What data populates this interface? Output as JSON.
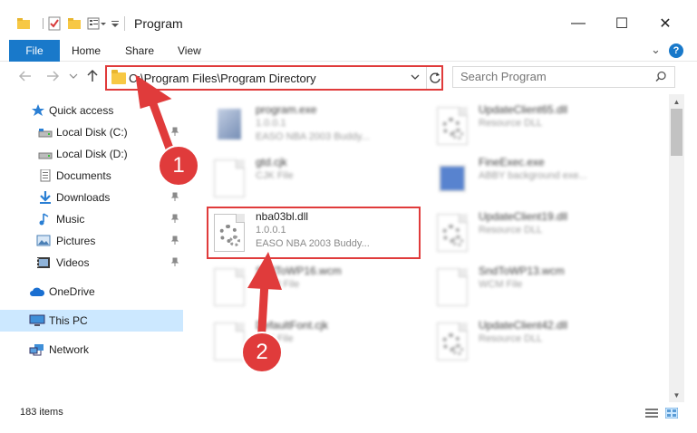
{
  "window": {
    "title": "Program",
    "minimize_glyph": "—",
    "maximize_glyph": "☐",
    "close_glyph": "✕"
  },
  "ribbon": {
    "file_tab": "File",
    "tabs": [
      "Home",
      "Share",
      "View"
    ],
    "expand_glyph": "⌄",
    "help_glyph": "?"
  },
  "nav": {
    "address": "C:\\Program Files\\Program Directory",
    "search_placeholder": "Search Program"
  },
  "sidebar": {
    "items": [
      {
        "label": "Quick access",
        "icon": "star-icon"
      },
      {
        "label": "Local Disk (C:)",
        "icon": "drive-icon"
      },
      {
        "label": "Local Disk (D:)",
        "icon": "drive-icon"
      },
      {
        "label": "Documents",
        "icon": "documents-icon"
      },
      {
        "label": "Downloads",
        "icon": "download-icon"
      },
      {
        "label": "Music",
        "icon": "music-icon"
      },
      {
        "label": "Pictures",
        "icon": "pictures-icon"
      },
      {
        "label": "Videos",
        "icon": "videos-icon"
      },
      {
        "label": "OneDrive",
        "icon": "cloud-icon"
      },
      {
        "label": "This PC",
        "icon": "computer-icon"
      },
      {
        "label": "Network",
        "icon": "network-icon"
      }
    ]
  },
  "files": {
    "program_exe": {
      "name": "program.exe",
      "line2": "1.0.0.1",
      "line3": "EASO NBA 2003 Buddy..."
    },
    "gtd_cjk": {
      "name": "gtd.cjk",
      "line2": "CJK File"
    },
    "nba03bl_dll": {
      "name": "nba03bl.dll",
      "line2": "1.0.0.1",
      "line3": "EASO NBA 2003 Buddy..."
    },
    "sndtowp16": {
      "name": "SndToWP16.wcm",
      "line2": "WCM File"
    },
    "defaultfont": {
      "name": "DefaultFont.cjk",
      "line2": "CJK File"
    },
    "updateclient65": {
      "name": "UpdateClient65.dll",
      "line2": "Resource DLL"
    },
    "fineexec": {
      "name": "FineExec.exe",
      "line2": "ABBY background exe..."
    },
    "updateclient19": {
      "name": "UpdateClient19.dll",
      "line2": "Resource DLL"
    },
    "sndtowp13": {
      "name": "SndToWP13.wcm",
      "line2": "WCM File"
    },
    "updateclient42": {
      "name": "UpdateClient42.dll",
      "line2": "Resource DLL"
    }
  },
  "status": {
    "item_count": "183 items"
  },
  "annotations": {
    "step1": "1",
    "step2": "2"
  },
  "colors": {
    "accent": "#1979ca",
    "highlight_red": "#e03b3b",
    "selected_bg": "#cce8ff"
  }
}
